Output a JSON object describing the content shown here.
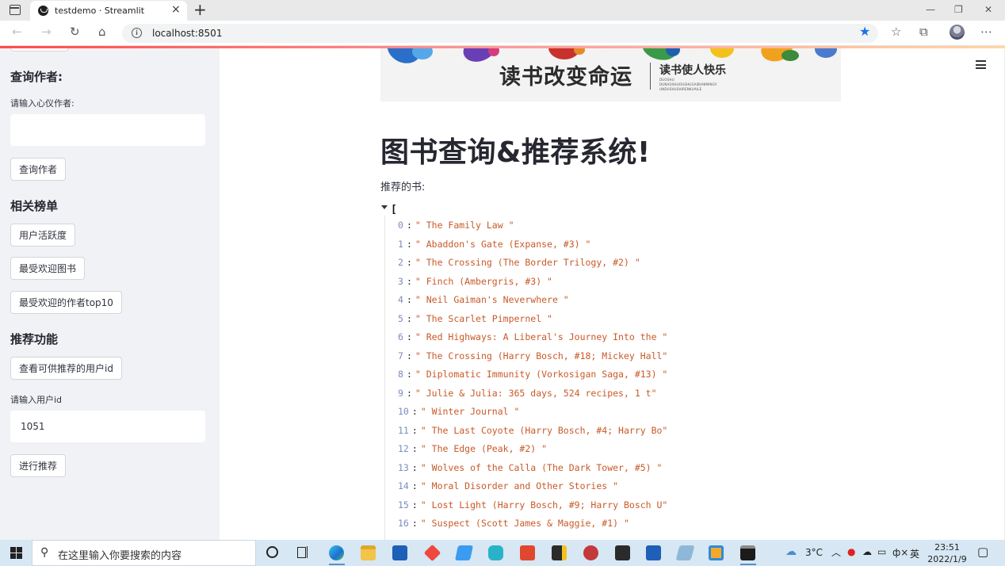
{
  "browser": {
    "tab_title": "testdemo · Streamlit",
    "url": "localhost:8501",
    "new_tab": "+",
    "tab_close": "×"
  },
  "sidebar": {
    "author_section_title": "查询作者:",
    "author_input_label": "请输入心仪作者:",
    "author_input_value": "",
    "author_button": "查询作者",
    "rank_section_title": "相关榜单",
    "rank_buttons": [
      "用户活跃度",
      "最受欢迎图书",
      "最受欢迎的作者top10"
    ],
    "recommend_section_title": "推荐功能",
    "show_users_button": "查看可供推荐的用户id",
    "user_id_label": "请输入用户id",
    "user_id_value": "1051",
    "recommend_button": "进行推荐"
  },
  "main": {
    "banner": {
      "main_text": "读书改变命运",
      "sub_text": "读书使人快乐",
      "pinyin_lines": [
        "DUOSHU",
        "DUNAOSHUOUSHUGAIBIANMINGY",
        "UNDUSHUSHIRENKUAILE"
      ]
    },
    "title": "图书查询&推荐系统!",
    "recommended_label": "推荐的书:",
    "json_open_bracket": "[",
    "books": [
      {
        "index": "0",
        "title": "\" The Family Law \""
      },
      {
        "index": "1",
        "title": "\" Abaddon's Gate (Expanse, #3) \""
      },
      {
        "index": "2",
        "title": "\" The Crossing (The Border Trilogy, #2) \""
      },
      {
        "index": "3",
        "title": "\" Finch (Ambergris, #3) \""
      },
      {
        "index": "4",
        "title": "\" Neil Gaiman's Neverwhere \""
      },
      {
        "index": "5",
        "title": "\" The Scarlet Pimpernel \""
      },
      {
        "index": "6",
        "title": "\" Red Highways: A Liberal's Journey Into the \""
      },
      {
        "index": "7",
        "title": "\" The Crossing (Harry Bosch, #18; Mickey Hall\""
      },
      {
        "index": "8",
        "title": "\" Diplomatic Immunity (Vorkosigan Saga, #13) \""
      },
      {
        "index": "9",
        "title": "\" Julie & Julia: 365 days, 524 recipes, 1 t\""
      },
      {
        "index": "10",
        "title": "\" Winter Journal \""
      },
      {
        "index": "11",
        "title": "\" The Last Coyote (Harry Bosch, #4; Harry Bo\""
      },
      {
        "index": "12",
        "title": "\" The Edge (Peak, #2) \""
      },
      {
        "index": "13",
        "title": "\" Wolves of the Calla (The Dark Tower, #5) \""
      },
      {
        "index": "14",
        "title": "\" Moral Disorder and Other Stories \""
      },
      {
        "index": "15",
        "title": "\" Lost Light (Harry Bosch, #9; Harry Bosch U\""
      },
      {
        "index": "16",
        "title": "\" Suspect (Scott James & Maggie, #1) \""
      }
    ]
  },
  "taskbar": {
    "search_placeholder": "在这里输入你要搜索的内容",
    "temperature": "3°C",
    "ime_lang": "英",
    "time": "23:51",
    "date": "2022/1/9",
    "tray_arrow": "︿",
    "volume": "ф×"
  },
  "colors": {
    "streamlit_red": "#ff4b4b",
    "sidebar_bg": "#f0f2f6",
    "json_value": "#c85a28",
    "json_index": "#7a8cc0",
    "taskbar_bg": "#d7e7f3"
  }
}
